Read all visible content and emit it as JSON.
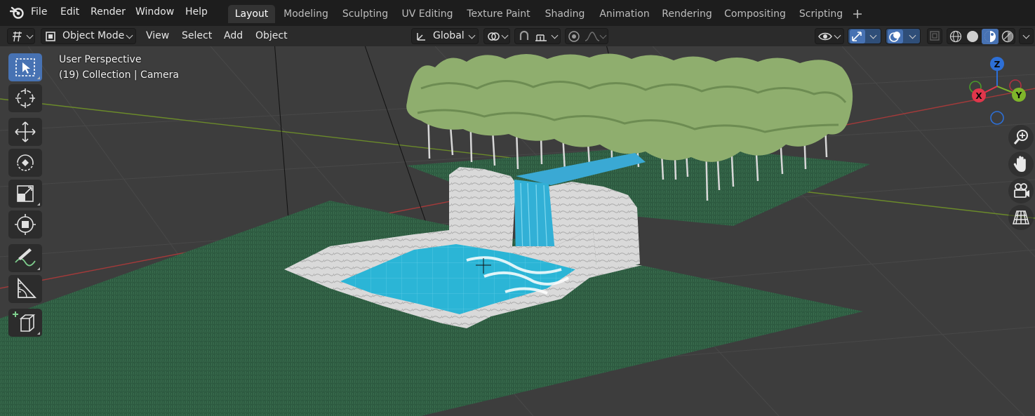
{
  "menu": {
    "items": [
      "File",
      "Edit",
      "Render",
      "Window",
      "Help"
    ],
    "logo_icon": "blender-logo-icon"
  },
  "workspaces": {
    "tabs": [
      "Layout",
      "Modeling",
      "Sculpting",
      "UV Editing",
      "Texture Paint",
      "Shading",
      "Animation",
      "Rendering",
      "Compositing",
      "Scripting"
    ],
    "active": "Layout",
    "add_icon": "plus-icon"
  },
  "header": {
    "editor_icon": "editor-type-icon",
    "mode": "Object Mode",
    "menus": [
      "View",
      "Select",
      "Add",
      "Object"
    ],
    "transform_orientation": "Global",
    "pivot_icon": "pivot-icon",
    "snap_icon": "snap-icon",
    "snap_target_icon": "snap-target-icon",
    "proportional_icon": "proportional-edit-icon",
    "falloff_icon": "falloff-icon",
    "visibility_icon": "eye-icon",
    "gizmo_icon": "gizmo-icon",
    "overlay_icon": "overlay-icon",
    "xray_icon": "xray-icon",
    "shading_modes": [
      "wireframe-icon",
      "solid-icon",
      "material-preview-icon",
      "rendered-icon"
    ],
    "active_shading": "material-preview-icon"
  },
  "viewport": {
    "view_name": "User Perspective",
    "collection_info": "(19) Collection | Camera",
    "colors": {
      "background": "#3d3d3d",
      "grass": "#2d5a40",
      "water": "#2bb5d6",
      "rock": "#d9d9d9",
      "tree": "#8fae6e",
      "x_axis": "#a33a3a",
      "y_axis": "#6b8a2a"
    }
  },
  "toolbar": {
    "tools": [
      {
        "name": "select-box",
        "icon": "select-box-icon",
        "active": true
      },
      {
        "name": "cursor",
        "icon": "cursor-icon",
        "active": false
      },
      {
        "name": "move",
        "icon": "move-icon",
        "active": false
      },
      {
        "name": "rotate",
        "icon": "rotate-icon",
        "active": false
      },
      {
        "name": "scale",
        "icon": "scale-icon",
        "active": false
      },
      {
        "name": "transform",
        "icon": "transform-icon",
        "active": false
      },
      {
        "name": "annotate",
        "icon": "annotate-icon",
        "active": false
      },
      {
        "name": "measure",
        "icon": "measure-icon",
        "active": false
      },
      {
        "name": "add-cube",
        "icon": "add-cube-icon",
        "active": false
      }
    ]
  },
  "gizmo": {
    "axes": [
      {
        "label": "Z",
        "color": "#2d6fd6"
      },
      {
        "label": "Y",
        "color": "#7fb52a"
      },
      {
        "label": "X",
        "color": "#e0364b"
      }
    ]
  },
  "navigation": {
    "buttons": [
      "zoom-icon",
      "hand-pan-icon",
      "camera-view-icon",
      "perspective-grid-icon"
    ]
  }
}
